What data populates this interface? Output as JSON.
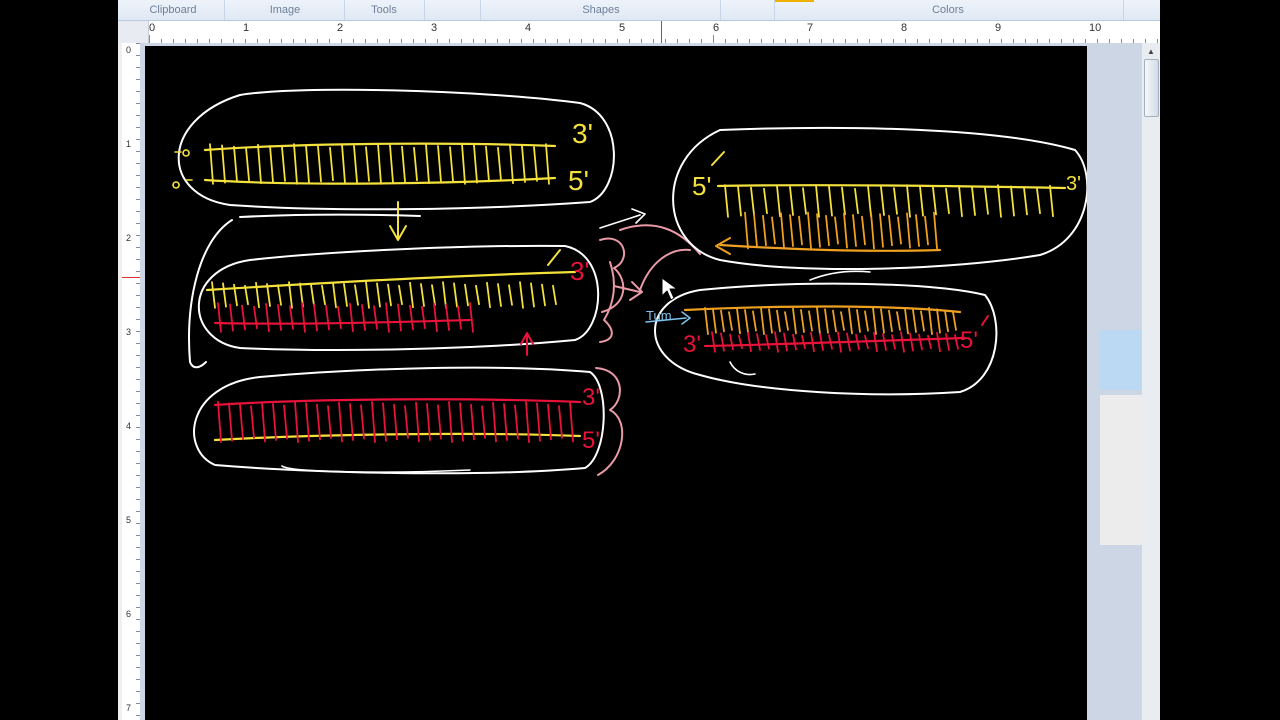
{
  "ribbon": {
    "groups": [
      "Clipboard",
      "Image",
      "Tools",
      "Shapes",
      "Colors"
    ]
  },
  "ruler": {
    "horizontal_numbers": [
      "0",
      "1",
      "2",
      "3",
      "4",
      "5",
      "6",
      "7",
      "8",
      "9",
      "10"
    ],
    "vertical_numbers": [
      "0",
      "1",
      "2",
      "3",
      "4",
      "5",
      "6",
      "7"
    ]
  },
  "drawing": {
    "labels": {
      "top_left_3prime": "3'",
      "top_left_5prime": "5'",
      "mid_left_3prime": "3'",
      "bottom_left_3prime": "3'",
      "bottom_left_5prime": "5'",
      "right_top_5prime": "5'",
      "right_top_3prime": "3'",
      "right_bottom_3prime": "3'",
      "right_bottom_5prime": "5'",
      "enzyme_label": "Tum"
    },
    "colors": {
      "background": "#000000",
      "outline": "#ffffff",
      "strand_parent": "#f4e13c",
      "strand_new": "#e8123a",
      "strand_okazaki": "#f0a020",
      "annotation": "#e89aa6",
      "enzyme": "#7fc4f0"
    }
  }
}
